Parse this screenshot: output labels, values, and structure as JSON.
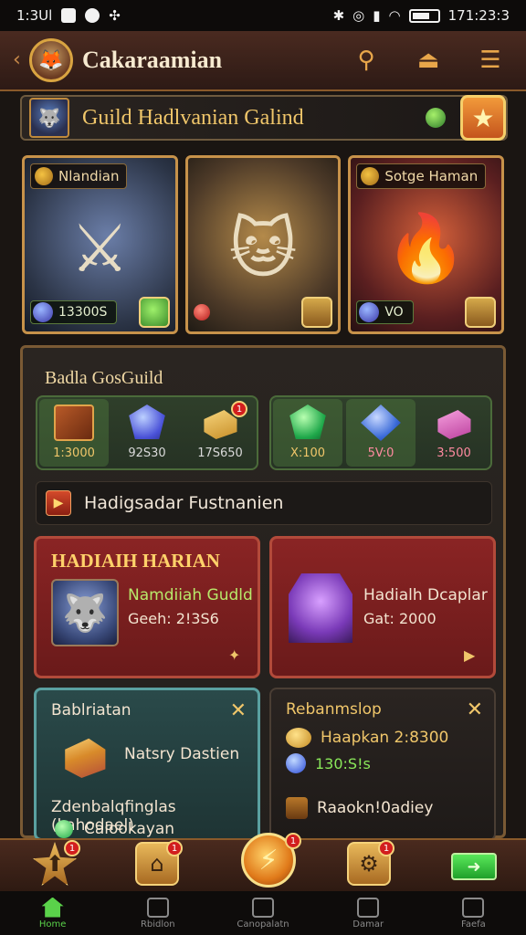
{
  "status_bar": {
    "time": "1:3Ul",
    "right_time": "171:23:3"
  },
  "header": {
    "title": "Cakaraamian",
    "icons": [
      "avatar",
      "search-icon",
      "summon-icon",
      "menu-icon"
    ]
  },
  "guild_banner": {
    "name": "Guild Hadlvanian Galind"
  },
  "heroes": [
    {
      "tag": "Nlandian",
      "value": "13300S"
    },
    {
      "tag": "",
      "value": ""
    },
    {
      "tag": "Sotge Haman",
      "value": "VO"
    }
  ],
  "panel": {
    "title": "Badla GosGuild",
    "resources_left": [
      {
        "icon": "book-icon",
        "value": "1:3000",
        "badge": ""
      },
      {
        "icon": "blue-gem-icon",
        "value": "92S30",
        "badge": ""
      },
      {
        "icon": "gold-bar-icon",
        "value": "17S650",
        "badge": "1"
      }
    ],
    "resources_right": [
      {
        "icon": "green-gem-icon",
        "value": "X:100",
        "badge": ""
      },
      {
        "icon": "blue-crystal-icon",
        "value": "5V:0",
        "badge": ""
      },
      {
        "icon": "pink-bar-icon",
        "value": "3:500",
        "badge": ""
      }
    ],
    "news": "Hadigsadar Fustnanien",
    "event_left": {
      "title": "HADIAIH HARIAN",
      "line1": "Namdiiah Gudld",
      "line2": "Geeh: 2!3S6"
    },
    "event_right": {
      "line1": "Hadialh Dcaplar",
      "line2": "Gat: 2000"
    },
    "card_bl": {
      "title": "Bablriatan",
      "text": "Natsry Dastien",
      "bottom1": "Zdenbalqfinglas (kahodael)",
      "bottom2": "Calookayan"
    },
    "card_br": {
      "title": "Rebanmslop",
      "row1": "Haapkan 2:8300",
      "row2": "130:S!s",
      "row3": "Raaokn!0adiey"
    }
  },
  "action_bar": {
    "badges": [
      "1",
      "1",
      "1",
      "1"
    ]
  },
  "bottom_nav": [
    {
      "label": "Home",
      "active": true
    },
    {
      "label": "Rbidlon",
      "active": false
    },
    {
      "label": "Canopalatn",
      "active": false
    },
    {
      "label": "Damar",
      "active": false
    },
    {
      "label": "Faefa",
      "active": false
    }
  ],
  "colors": {
    "accent_gold": "#f0c66a",
    "accent_green": "#5ad24a",
    "panel_border": "#7a5a34",
    "event_red": "#8a2424"
  }
}
